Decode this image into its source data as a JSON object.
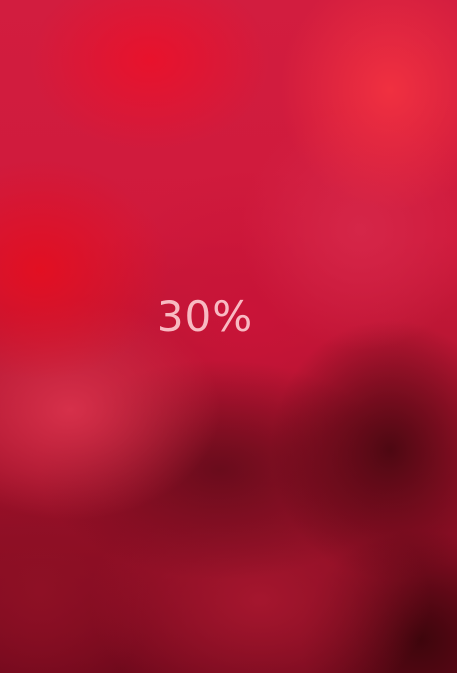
{
  "progress": {
    "label": "30%",
    "value": 0.3
  },
  "colors": {
    "background_primary": "#c8143a",
    "background_dark": "#4e0812",
    "text": "#ffd2d6"
  }
}
